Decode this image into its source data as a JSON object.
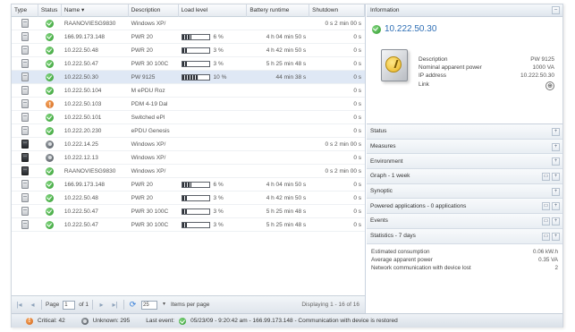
{
  "table": {
    "columns": [
      "Type",
      "Status",
      "Name ▾",
      "Description",
      "Load level",
      "Battery runtime",
      "Shutdown"
    ],
    "rows": [
      {
        "type": "light",
        "status": "ok",
        "name": "RAANOVIESG9830",
        "desc": "Windows XP/",
        "load_pct": null,
        "load_text": "",
        "batt": "",
        "shut": "0 s  2 min 00 s"
      },
      {
        "type": "light",
        "status": "ok",
        "name": "166.99.173.148",
        "desc": "PWR 20",
        "load_pct": 6,
        "load_text": "6 %",
        "batt": "4 h 04 min 50 s",
        "shut": "0 s"
      },
      {
        "type": "light",
        "status": "ok",
        "name": "10.222.50.48",
        "desc": "PWR 20",
        "load_pct": 3,
        "load_text": "3 %",
        "batt": "4 h 42 min 50 s",
        "shut": "0 s"
      },
      {
        "type": "light",
        "status": "ok",
        "name": "10.222.50.47",
        "desc": "PWR 30 100C",
        "load_pct": 3,
        "load_text": "3 %",
        "batt": "5 h 25 min 48 s",
        "shut": "0 s"
      },
      {
        "type": "light",
        "status": "ok",
        "name": "10.222.50.30",
        "desc": "PW 9125",
        "load_pct": 10,
        "load_text": "10 %",
        "batt": "44 min 38 s",
        "shut": "0 s",
        "selected": true
      },
      {
        "type": "light",
        "status": "ok",
        "name": "10.222.50.104",
        "desc": "M ePDU Roz",
        "load_pct": null,
        "load_text": "",
        "batt": "",
        "shut": "0 s"
      },
      {
        "type": "light",
        "status": "warn",
        "name": "10.222.50.103",
        "desc": "PDM 4-19 Dal",
        "load_pct": null,
        "load_text": "",
        "batt": "",
        "shut": "0 s"
      },
      {
        "type": "light",
        "status": "ok",
        "name": "10.222.50.101",
        "desc": "Switched ePl",
        "load_pct": null,
        "load_text": "",
        "batt": "",
        "shut": "0 s"
      },
      {
        "type": "light",
        "status": "ok",
        "name": "10.222.20.230",
        "desc": "ePDU Genesis",
        "load_pct": null,
        "load_text": "",
        "batt": "",
        "shut": "0 s"
      },
      {
        "type": "dark",
        "status": "unk",
        "name": "10.222.14.25",
        "desc": "Windows XP/",
        "load_pct": null,
        "load_text": "",
        "batt": "",
        "shut": "0 s  2 min 00 s"
      },
      {
        "type": "dark",
        "status": "unk",
        "name": "10.222.12.13",
        "desc": "Windows XP/",
        "load_pct": null,
        "load_text": "",
        "batt": "",
        "shut": "0 s"
      },
      {
        "type": "dark",
        "status": "ok",
        "name": "RAANOVIESG9830",
        "desc": "Windows XP/",
        "load_pct": null,
        "load_text": "",
        "batt": "",
        "shut": "0 s  2 min 00 s"
      },
      {
        "type": "light",
        "status": "ok",
        "name": "166.99.173.148",
        "desc": "PWR 20",
        "load_pct": 6,
        "load_text": "6 %",
        "batt": "4 h 04 min 50 s",
        "shut": "0 s"
      },
      {
        "type": "light",
        "status": "ok",
        "name": "10.222.50.48",
        "desc": "PWR 20",
        "load_pct": 3,
        "load_text": "3 %",
        "batt": "4 h 42 min 50 s",
        "shut": "0 s"
      },
      {
        "type": "light",
        "status": "ok",
        "name": "10.222.50.47",
        "desc": "PWR 30 100C",
        "load_pct": 3,
        "load_text": "3 %",
        "batt": "5 h 25 min 48 s",
        "shut": "0 s"
      },
      {
        "type": "light",
        "status": "ok",
        "name": "10.222.50.47",
        "desc": "PWR 30 100C",
        "load_pct": 3,
        "load_text": "3 %",
        "batt": "5 h 25 min 48 s",
        "shut": "0 s"
      }
    ]
  },
  "pager": {
    "page_label": "Page",
    "page_value": "1",
    "of_label": "of 1",
    "per_page_value": "25",
    "per_page_label": "Items per page",
    "displaying": "Displaying 1 - 16 of 16"
  },
  "statusbar": {
    "critical": "Critical: 42",
    "unknown": "Unknown: 295",
    "last_event_label": "Last event:",
    "last_event": "05/23/09 - 9:20:42 am - 166.99.173.148 - Communication with device is restored"
  },
  "panel": {
    "info_title": "Information",
    "ip": "10.222.50.30",
    "fields": [
      {
        "k": "Description",
        "v": "PW 9125"
      },
      {
        "k": "Nominal apparent power",
        "v": "1000 VA"
      },
      {
        "k": "IP address",
        "v": "10.222.50.30"
      },
      {
        "k": "Link",
        "v": ""
      }
    ],
    "sections": [
      {
        "label": "Status",
        "extra": false
      },
      {
        "label": "Measures",
        "extra": false
      },
      {
        "label": "Environment",
        "extra": false
      },
      {
        "label": "Graph - 1 week",
        "extra": true
      },
      {
        "label": "Synoptic",
        "extra": false
      },
      {
        "label": "Powered applications - 0 applications",
        "extra": true
      },
      {
        "label": "Events",
        "extra": true
      },
      {
        "label": "Statistics - 7 days",
        "extra": true
      }
    ],
    "stats": [
      {
        "k": "Estimated consumption",
        "v": "0.06 kW.h"
      },
      {
        "k": "Average apparent power",
        "v": "0.35 VA"
      },
      {
        "k": "Network communication with device lost",
        "v": "2"
      }
    ]
  }
}
